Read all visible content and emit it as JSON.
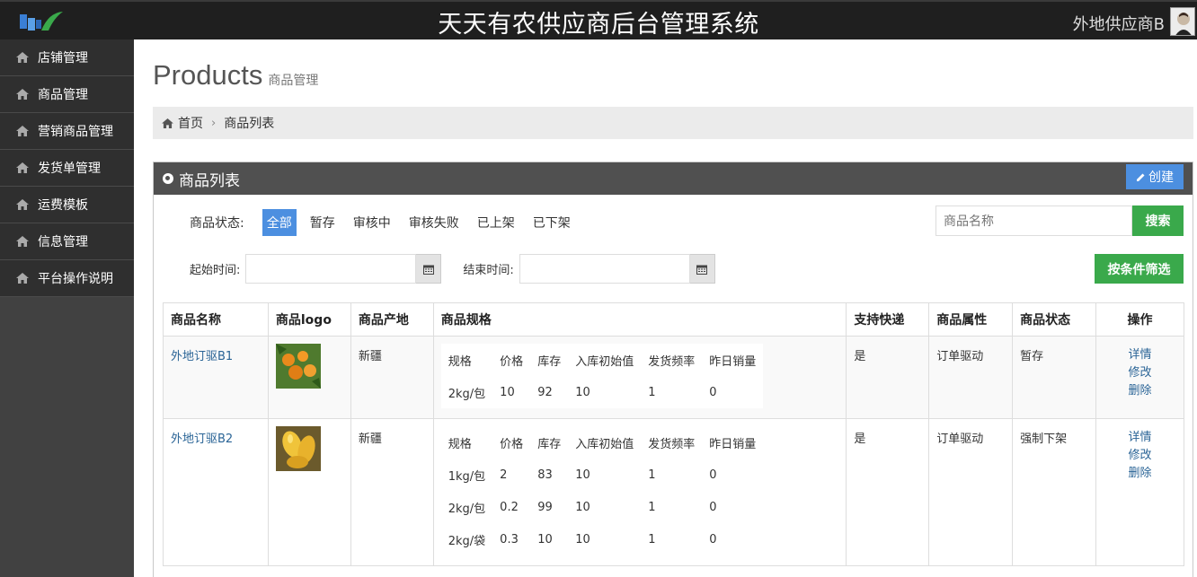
{
  "header": {
    "title": "天天有农供应商后台管理系统",
    "user_name": "外地供应商B"
  },
  "sidebar": {
    "items": [
      {
        "label": "店铺管理"
      },
      {
        "label": "商品管理"
      },
      {
        "label": "营销商品管理"
      },
      {
        "label": "发货单管理"
      },
      {
        "label": "运费模板"
      },
      {
        "label": "信息管理"
      },
      {
        "label": "平台操作说明"
      }
    ]
  },
  "page": {
    "title": "Products",
    "subtitle": "商品管理"
  },
  "breadcrumb": {
    "home": "首页",
    "current": "商品列表"
  },
  "panel": {
    "title": "商品列表",
    "create_label": "创建"
  },
  "filters": {
    "status_label": "商品状态:",
    "status_options": [
      "全部",
      "暂存",
      "审核中",
      "审核失败",
      "已上架",
      "已下架"
    ],
    "active_status": "全部",
    "search_placeholder": "商品名称",
    "search_button": "搜索",
    "start_label": "起始时间:",
    "end_label": "结束时间:",
    "filter_button": "按条件筛选"
  },
  "table": {
    "headers": [
      "商品名称",
      "商品logo",
      "商品产地",
      "商品规格",
      "支持快递",
      "商品属性",
      "商品状态",
      "操作"
    ],
    "spec_headers": [
      "规格",
      "价格",
      "库存",
      "入库初始值",
      "发货频率",
      "昨日销量"
    ],
    "actions": [
      "详情",
      "修改",
      "删除"
    ],
    "rows": [
      {
        "name": "外地订驱B1",
        "origin": "新疆",
        "specs": [
          [
            "2kg/包",
            "10",
            "92",
            "10",
            "1",
            "0"
          ]
        ],
        "express": "是",
        "attribute": "订单驱动",
        "status": "暂存"
      },
      {
        "name": "外地订驱B2",
        "origin": "新疆",
        "specs": [
          [
            "1kg/包",
            "2",
            "83",
            "10",
            "1",
            "0"
          ],
          [
            "2kg/包",
            "0.2",
            "99",
            "10",
            "1",
            "0"
          ],
          [
            "2kg/袋",
            "0.3",
            "10",
            "10",
            "1",
            "0"
          ]
        ],
        "express": "是",
        "attribute": "订单驱动",
        "status": "强制下架"
      }
    ]
  },
  "colors": {
    "accent_blue": "#4c8fe0",
    "green": "#3aa94b",
    "topbar": "#1f1f1f",
    "sidebar": "#2f2f2f"
  }
}
